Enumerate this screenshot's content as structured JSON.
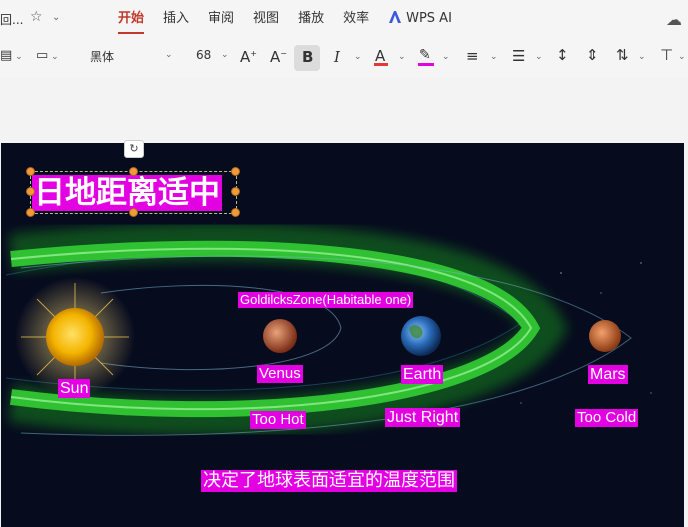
{
  "topbar": {
    "left_fragment": "回...",
    "tabs": [
      {
        "label": "开始",
        "active": true
      },
      {
        "label": "插入"
      },
      {
        "label": "审阅"
      },
      {
        "label": "视图"
      },
      {
        "label": "播放"
      },
      {
        "label": "效率"
      },
      {
        "label": "WPS AI"
      }
    ]
  },
  "toolbar": {
    "font_name": "黑体",
    "font_size": "68",
    "bold": "B",
    "italic": "I",
    "font_color": "A",
    "accent_color": "#e53935",
    "highlight_color": "#e300e3"
  },
  "slide": {
    "title": "日地距离适中",
    "zone_label": "GoldilcksZone(Habitable one)",
    "planets": [
      {
        "name": "Sun"
      },
      {
        "name": "Venus"
      },
      {
        "name": "Earth"
      },
      {
        "name": "Mars"
      }
    ],
    "temps": [
      "Too  Hot",
      "Just Right",
      "Too Cold"
    ],
    "caption": "决定了地球表面适宜的温度范围"
  }
}
